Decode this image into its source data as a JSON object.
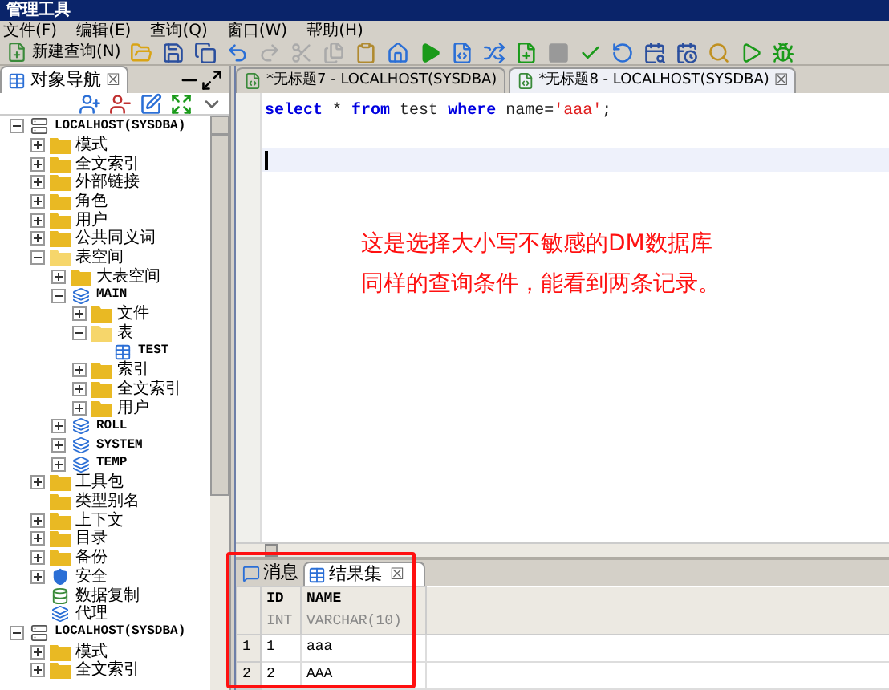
{
  "window": {
    "title": "管理工具"
  },
  "menu": [
    "文件(F)",
    "编辑(E)",
    "查询(Q)",
    "窗口(W)",
    "帮助(H)"
  ],
  "toolbar": {
    "new_query": "新建查询(N)"
  },
  "navigator": {
    "title": "对象导航",
    "close": "☒",
    "tree": [
      {
        "label": "LOCALHOST(SYSDBA)",
        "kind": "server",
        "expanded": true,
        "children": [
          {
            "label": "模式",
            "kind": "folder",
            "expanded": false
          },
          {
            "label": "全文索引",
            "kind": "folder",
            "expanded": false
          },
          {
            "label": "外部链接",
            "kind": "folder",
            "expanded": false
          },
          {
            "label": "角色",
            "kind": "folder",
            "expanded": false
          },
          {
            "label": "用户",
            "kind": "folder",
            "expanded": false
          },
          {
            "label": "公共同义词",
            "kind": "folder",
            "expanded": false
          },
          {
            "label": "表空间",
            "kind": "folder",
            "expanded": true,
            "children": [
              {
                "label": "大表空间",
                "kind": "folder",
                "expanded": false
              },
              {
                "label": "MAIN",
                "kind": "tablespace",
                "expanded": true,
                "children": [
                  {
                    "label": "文件",
                    "kind": "folder",
                    "expanded": false
                  },
                  {
                    "label": "表",
                    "kind": "folder",
                    "expanded": true,
                    "children": [
                      {
                        "label": "TEST",
                        "kind": "table"
                      }
                    ]
                  },
                  {
                    "label": "索引",
                    "kind": "folder",
                    "expanded": false
                  },
                  {
                    "label": "全文索引",
                    "kind": "folder",
                    "expanded": false
                  },
                  {
                    "label": "用户",
                    "kind": "folder",
                    "expanded": false
                  }
                ]
              },
              {
                "label": "ROLL",
                "kind": "tablespace",
                "expanded": false
              },
              {
                "label": "SYSTEM",
                "kind": "tablespace",
                "expanded": false
              },
              {
                "label": "TEMP",
                "kind": "tablespace",
                "expanded": false
              }
            ]
          },
          {
            "label": "工具包",
            "kind": "folder",
            "expanded": false
          },
          {
            "label": "类型别名",
            "kind": "folder"
          },
          {
            "label": "上下文",
            "kind": "folder",
            "expanded": false
          },
          {
            "label": "目录",
            "kind": "folder",
            "expanded": false
          },
          {
            "label": "备份",
            "kind": "folder",
            "expanded": false
          },
          {
            "label": "安全",
            "kind": "shield",
            "expanded": false
          },
          {
            "label": "数据复制",
            "kind": "replication"
          },
          {
            "label": "代理",
            "kind": "agent"
          }
        ]
      },
      {
        "label": "LOCALHOST(SYSDBA)",
        "kind": "server",
        "expanded": true,
        "children": [
          {
            "label": "模式",
            "kind": "folder",
            "expanded": false
          },
          {
            "label": "全文索引",
            "kind": "folder",
            "expanded": false
          }
        ]
      }
    ]
  },
  "editor_tabs": [
    {
      "label": "*无标题7 - LOCALHOST(SYSDBA)",
      "selected": false
    },
    {
      "label": "*无标题8 - LOCALHOST(SYSDBA)",
      "selected": true,
      "close": "☒"
    }
  ],
  "editor": {
    "lines": [
      {
        "current": false,
        "tokens": [
          {
            "text": "select",
            "kind": "keyword"
          },
          {
            "text": " * ",
            "kind": "plain"
          },
          {
            "text": "from",
            "kind": "keyword"
          },
          {
            "text": " test ",
            "kind": "plain"
          },
          {
            "text": "where",
            "kind": "keyword"
          },
          {
            "text": " name=",
            "kind": "plain"
          },
          {
            "text": "'aaa'",
            "kind": "string"
          },
          {
            "text": ";",
            "kind": "plain"
          }
        ]
      },
      {
        "current": false
      },
      {
        "current": true
      }
    ]
  },
  "annotation": [
    "这是选择大小写不敏感的DM数据库",
    "同样的查询条件，能看到两条记录。"
  ],
  "result_tabs": [
    {
      "label": "消息",
      "kind": "messages",
      "selected": false
    },
    {
      "label": "结果集",
      "kind": "resultset",
      "selected": true,
      "close": "☒"
    }
  ],
  "result_table": {
    "columns": [
      {
        "name": "ID",
        "type": "INT"
      },
      {
        "name": "NAME",
        "type": "VARCHAR(10)"
      }
    ],
    "rows": [
      {
        "number": "1",
        "cells": [
          "1",
          "aaa"
        ]
      },
      {
        "number": "2",
        "cells": [
          "2",
          "AAA"
        ]
      }
    ]
  }
}
